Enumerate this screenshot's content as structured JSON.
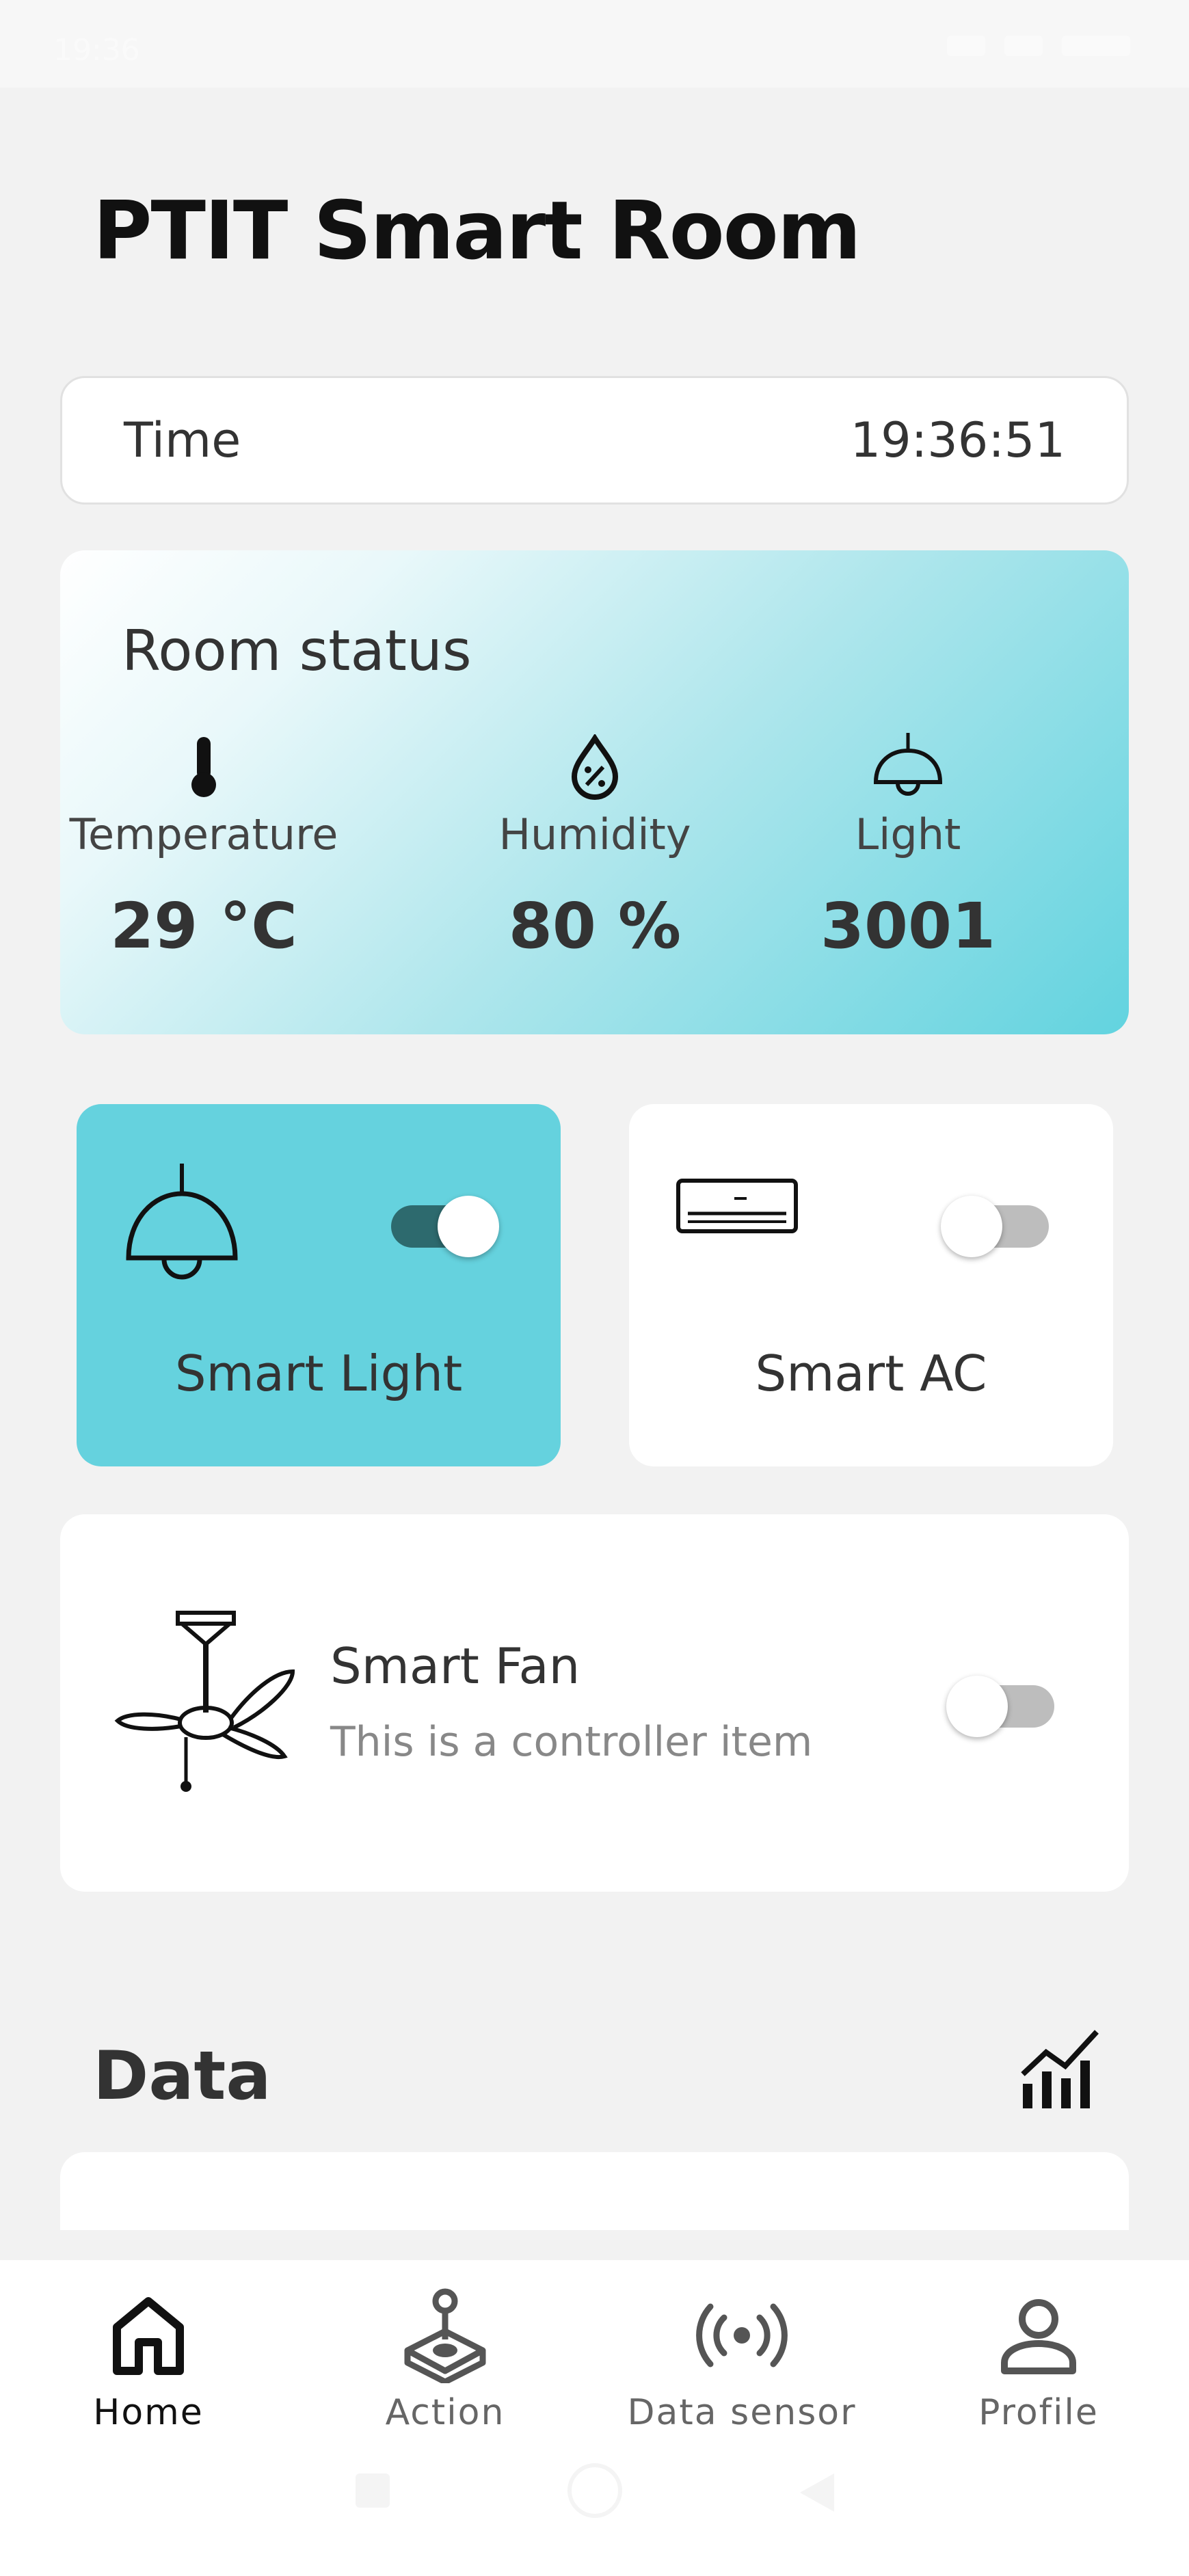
{
  "status_bar": {
    "time": "19:36"
  },
  "app": {
    "title": "PTIT Smart Room"
  },
  "time_card": {
    "label": "Time",
    "value": "19:36:51"
  },
  "room_status": {
    "title": "Room status",
    "metrics": [
      {
        "label": "Temperature",
        "value": "29 °C",
        "icon": "thermometer-icon"
      },
      {
        "label": "Humidity",
        "value": "80 %",
        "icon": "humidity-icon"
      },
      {
        "label": "Light",
        "value": "3001",
        "icon": "lamp-icon"
      }
    ]
  },
  "devices": {
    "light": {
      "label": "Smart Light",
      "on": true
    },
    "ac": {
      "label": "Smart AC",
      "on": false
    },
    "fan": {
      "label": "Smart Fan",
      "subtitle": "This is a controller item",
      "on": false
    }
  },
  "data_section": {
    "title": "Data",
    "icon": "chart-icon"
  },
  "bottom_nav": [
    {
      "label": "Home",
      "icon": "home-icon",
      "active": true
    },
    {
      "label": "Action",
      "icon": "joystick-icon",
      "active": false
    },
    {
      "label": "Data sensor",
      "icon": "sensor-icon",
      "active": false
    },
    {
      "label": "Profile",
      "icon": "profile-icon",
      "active": false
    }
  ],
  "colors": {
    "accent": "#65d2de",
    "toggle_on": "#2d6a6e",
    "toggle_off": "#bdbdbd",
    "background": "#f2f2f2"
  }
}
